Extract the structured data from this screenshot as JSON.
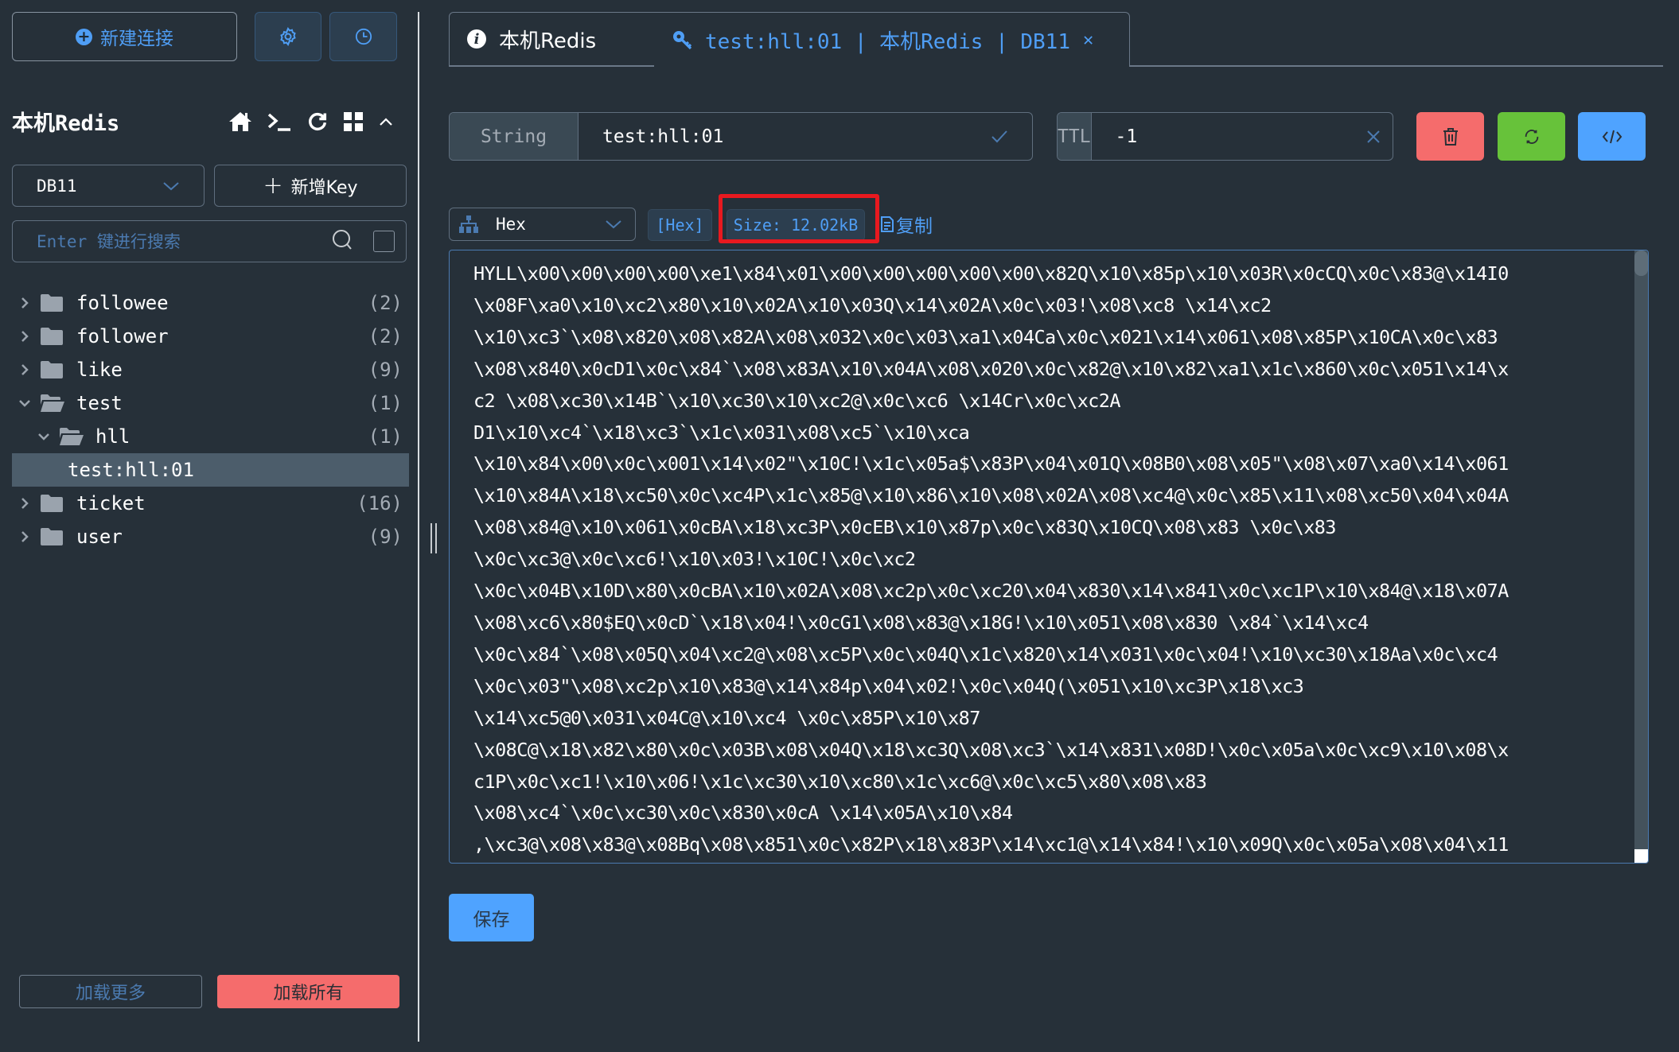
{
  "sidebar": {
    "new_connection_label": "新建连接",
    "settings_icon": "gear-icon",
    "history_icon": "clock-icon",
    "connection_name": "本机Redis",
    "toolbar_icons": [
      "home-icon",
      "terminal-icon",
      "refresh-icon",
      "grid-icon",
      "chevron-up-icon"
    ],
    "db_select": {
      "value": "DB11"
    },
    "add_key_label": "新增Key",
    "search": {
      "placeholder": "Enter 键进行搜索",
      "value": ""
    },
    "tree": [
      {
        "label": "followee",
        "count": "(2)",
        "expanded": false,
        "level": 0,
        "type": "folder"
      },
      {
        "label": "follower",
        "count": "(2)",
        "expanded": false,
        "level": 0,
        "type": "folder"
      },
      {
        "label": "like",
        "count": "(9)",
        "expanded": false,
        "level": 0,
        "type": "folder"
      },
      {
        "label": "test",
        "count": "(1)",
        "expanded": true,
        "level": 0,
        "type": "folder"
      },
      {
        "label": "hll",
        "count": "(1)",
        "expanded": true,
        "level": 1,
        "type": "folder"
      },
      {
        "label": "test:hll:01",
        "count": "",
        "level": 2,
        "type": "key",
        "selected": true
      },
      {
        "label": "ticket",
        "count": "(16)",
        "expanded": false,
        "level": 0,
        "type": "folder"
      },
      {
        "label": "user",
        "count": "(9)",
        "expanded": false,
        "level": 0,
        "type": "folder"
      }
    ],
    "load_more_label": "加载更多",
    "load_all_label": "加载所有"
  },
  "tabs": [
    {
      "label": "本机Redis",
      "icon": "info-icon",
      "active": false
    },
    {
      "label": "test:hll:01 | 本机Redis | DB11",
      "icon": "key-icon",
      "active": true,
      "closable": true
    }
  ],
  "key_editor": {
    "type": "String",
    "key_name": "test:hll:01",
    "ttl_label": "TTL",
    "ttl_value": "-1",
    "actions": [
      {
        "name": "delete",
        "icon": "trash-icon",
        "color": "#f56c6c"
      },
      {
        "name": "refresh",
        "icon": "refresh-icon",
        "color": "#67c23a"
      },
      {
        "name": "code",
        "icon": "code-icon",
        "color": "#4fa3ff"
      }
    ]
  },
  "format": {
    "selected": "Hex",
    "tag": "[Hex]",
    "size": "Size: 12.02kB",
    "copy_label": "复制"
  },
  "value_lines": [
    "HYLL\\x00\\x00\\x00\\x00\\xe1\\x84\\x01\\x00\\x00\\x00\\x00\\x00\\x82Q\\x10\\x85p\\x10\\x03R\\x0cCQ\\x0c\\x83@\\x14I0",
    "\\x08F\\xa0\\x10\\xc2\\x80\\x10\\x02A\\x10\\x03Q\\x14\\x02A\\x0c\\x03!\\x08\\xc8 \\x14\\xc2",
    "\\x10\\xc3`\\x08\\x820\\x08\\x82A\\x08\\x032\\x0c\\x03\\xa1\\x04Ca\\x0c\\x021\\x14\\x061\\x08\\x85P\\x10CA\\x0c\\x83",
    "\\x08\\x840\\x0cD1\\x0c\\x84`\\x08\\x83A\\x10\\x04A\\x08\\x020\\x0c\\x82@\\x10\\x82\\xa1\\x1c\\x860\\x0c\\x051\\x14\\x",
    "c2 \\x08\\xc30\\x14B`\\x10\\xc30\\x10\\xc2@\\x0c\\xc6 \\x14Cr\\x0c\\xc2A",
    "D1\\x10\\xc4`\\x18\\xc3`\\x1c\\x031\\x08\\xc5`\\x10\\xca",
    "\\x10\\x84\\x00\\x0c\\x001\\x14\\x02\"\\x10C!\\x1c\\x05a$\\x83P\\x04\\x01Q\\x08B0\\x08\\x05\"\\x08\\x07\\xa0\\x14\\x061",
    "\\x10\\x84A\\x18\\xc50\\x0c\\xc4P\\x1c\\x85@\\x10\\x86\\x10\\x08\\x02A\\x08\\xc4@\\x0c\\x85\\x11\\x08\\xc50\\x04\\x04A",
    "\\x08\\x84@\\x10\\x061\\x0cBA\\x18\\xc3P\\x0cEB\\x10\\x87p\\x0c\\x83Q\\x10CQ\\x08\\x83 \\x0c\\x83",
    "\\x0c\\xc3@\\x0c\\xc6!\\x10\\x03!\\x10C!\\x0c\\xc2",
    "\\x0c\\x04B\\x10D\\x80\\x0cBA\\x10\\x02A\\x08\\xc2p\\x0c\\xc20\\x04\\x830\\x14\\x841\\x0c\\xc1P\\x10\\x84@\\x18\\x07A",
    "\\x08\\xc6\\x80$EQ\\x0cD`\\x18\\x04!\\x0cG1\\x08\\x83@\\x18G!\\x10\\x051\\x08\\x830 \\x84`\\x14\\xc4",
    "\\x0c\\x84`\\x08\\x05Q\\x04\\xc2@\\x08\\xc5P\\x0c\\x04Q\\x1c\\x820\\x14\\x031\\x0c\\x04!\\x10\\xc30\\x18Aa\\x0c\\xc4",
    "\\x0c\\x03\"\\x08\\xc2p\\x10\\x83@\\x14\\x84p\\x04\\x02!\\x0c\\x04Q(\\x051\\x10\\xc3P\\x18\\xc3",
    "\\x14\\xc5@0\\x031\\x04C@\\x10\\xc4 \\x0c\\x85P\\x10\\x87",
    "\\x08C@\\x18\\x82\\x80\\x0c\\x03B\\x08\\x04Q\\x18\\xc3Q\\x08\\xc3`\\x14\\x831\\x08D!\\x0c\\x05a\\x0c\\xc9\\x10\\x08\\x",
    "c1P\\x0c\\xc1!\\x10\\x06!\\x1c\\xc30\\x10\\xc80\\x1c\\xc6@\\x0c\\xc5\\x80\\x08\\x83",
    "\\x08\\xc4`\\x0c\\xc30\\x0c\\x830\\x0cA \\x14\\x05A\\x10\\x84",
    ",\\xc3@\\x08\\x83@\\x08Bq\\x08\\x851\\x0c\\x82P\\x18\\x83P\\x14\\xc1@\\x14\\x84!\\x10\\x09Q\\x0c\\x05a\\x08\\x04\\x11"
  ],
  "save_label": "保存",
  "colors": {
    "background": "#263039",
    "accent": "#4f9ef5",
    "danger": "#f56c6c",
    "success": "#67c23a",
    "primary": "#4fa3ff",
    "highlight": "#e8191f"
  }
}
